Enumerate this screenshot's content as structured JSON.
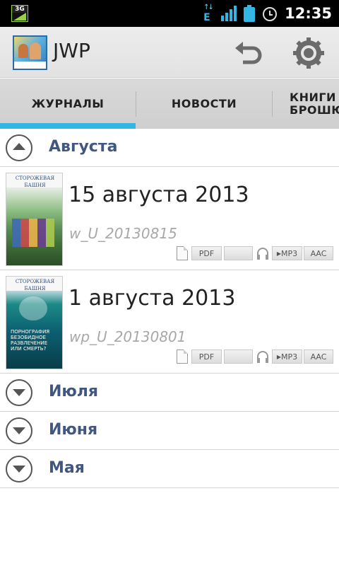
{
  "status_bar": {
    "network_label": "3G",
    "data_label": "E",
    "time": "12:35"
  },
  "action_bar": {
    "title": "JWP",
    "icons": [
      "app-logo",
      "undo-icon",
      "settings-icon"
    ]
  },
  "tabs": {
    "items": [
      {
        "label": "ЖУРНАЛЫ",
        "selected": true
      },
      {
        "label": "НОВОСТИ",
        "selected": false
      },
      {
        "label_line1": "КНИГИ И",
        "label_line2": "БРОШЮ",
        "selected": false
      }
    ],
    "accent_color": "#33b5e5"
  },
  "groups": [
    {
      "label": "Августа",
      "expanded": true,
      "issues": [
        {
          "title": "15 августа 2013",
          "code": "w_U_20130815",
          "cover_masthead": "СТОРОЖЕВАЯ БАШНЯ",
          "formats": {
            "pdf": "PDF",
            "mp3": "MP3",
            "aac": "AAC"
          }
        },
        {
          "title": "1 августа 2013",
          "code": "wp_U_20130801",
          "cover_masthead": "СТОРОЖЕВАЯ БАШНЯ",
          "cover_text": "ПОРНОГРАФИЯ БЕЗОБИДНОЕ РАЗВЛЕЧЕНИЕ ИЛИ СМЕРТЬ?",
          "formats": {
            "pdf": "PDF",
            "mp3": "MP3",
            "aac": "AAC"
          }
        }
      ]
    },
    {
      "label": "Июля",
      "expanded": false
    },
    {
      "label": "Июня",
      "expanded": false
    },
    {
      "label": "Мая",
      "expanded": false
    }
  ],
  "colors": {
    "group_label": "#41577f",
    "code_text": "#a8a8a8"
  }
}
